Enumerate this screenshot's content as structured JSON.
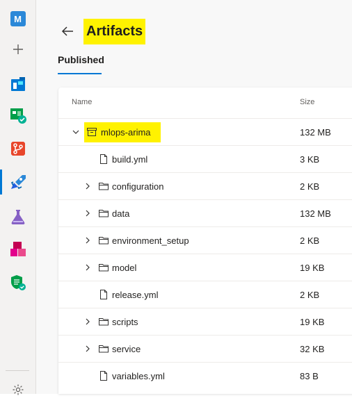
{
  "sidebar": {
    "org_initial": "M",
    "items": [
      {
        "name": "organization",
        "icon": "org-icon"
      },
      {
        "name": "new",
        "icon": "plus-icon"
      },
      {
        "name": "boards",
        "icon": "boards-icon"
      },
      {
        "name": "test-plans-board",
        "icon": "board-check-icon"
      },
      {
        "name": "repos",
        "icon": "repos-icon"
      },
      {
        "name": "pipelines",
        "icon": "pipelines-icon",
        "active": true
      },
      {
        "name": "test-plans",
        "icon": "flask-icon"
      },
      {
        "name": "artifacts",
        "icon": "artifacts-icon"
      },
      {
        "name": "security",
        "icon": "shield-icon"
      },
      {
        "name": "settings",
        "icon": "gear-icon"
      }
    ]
  },
  "header": {
    "title": "Artifacts",
    "tab": "Published"
  },
  "table": {
    "columns": {
      "name": "Name",
      "size": "Size"
    },
    "rows": [
      {
        "name": "mlops-arima",
        "size": "132 MB",
        "type": "artifact",
        "expanded": true,
        "level": 0
      },
      {
        "name": "build.yml",
        "size": "3 KB",
        "type": "file",
        "level": 1
      },
      {
        "name": "configuration",
        "size": "2 KB",
        "type": "folder",
        "level": 1
      },
      {
        "name": "data",
        "size": "132 MB",
        "type": "folder",
        "level": 1
      },
      {
        "name": "environment_setup",
        "size": "2 KB",
        "type": "folder",
        "level": 1
      },
      {
        "name": "model",
        "size": "19 KB",
        "type": "folder",
        "level": 1
      },
      {
        "name": "release.yml",
        "size": "2 KB",
        "type": "file",
        "level": 1
      },
      {
        "name": "scripts",
        "size": "19 KB",
        "type": "folder",
        "level": 1
      },
      {
        "name": "service",
        "size": "32 KB",
        "type": "folder",
        "level": 1
      },
      {
        "name": "variables.yml",
        "size": "83 B",
        "type": "file",
        "level": 1
      }
    ]
  },
  "colors": {
    "accent": "#0078d4",
    "highlight": "#fff200"
  }
}
